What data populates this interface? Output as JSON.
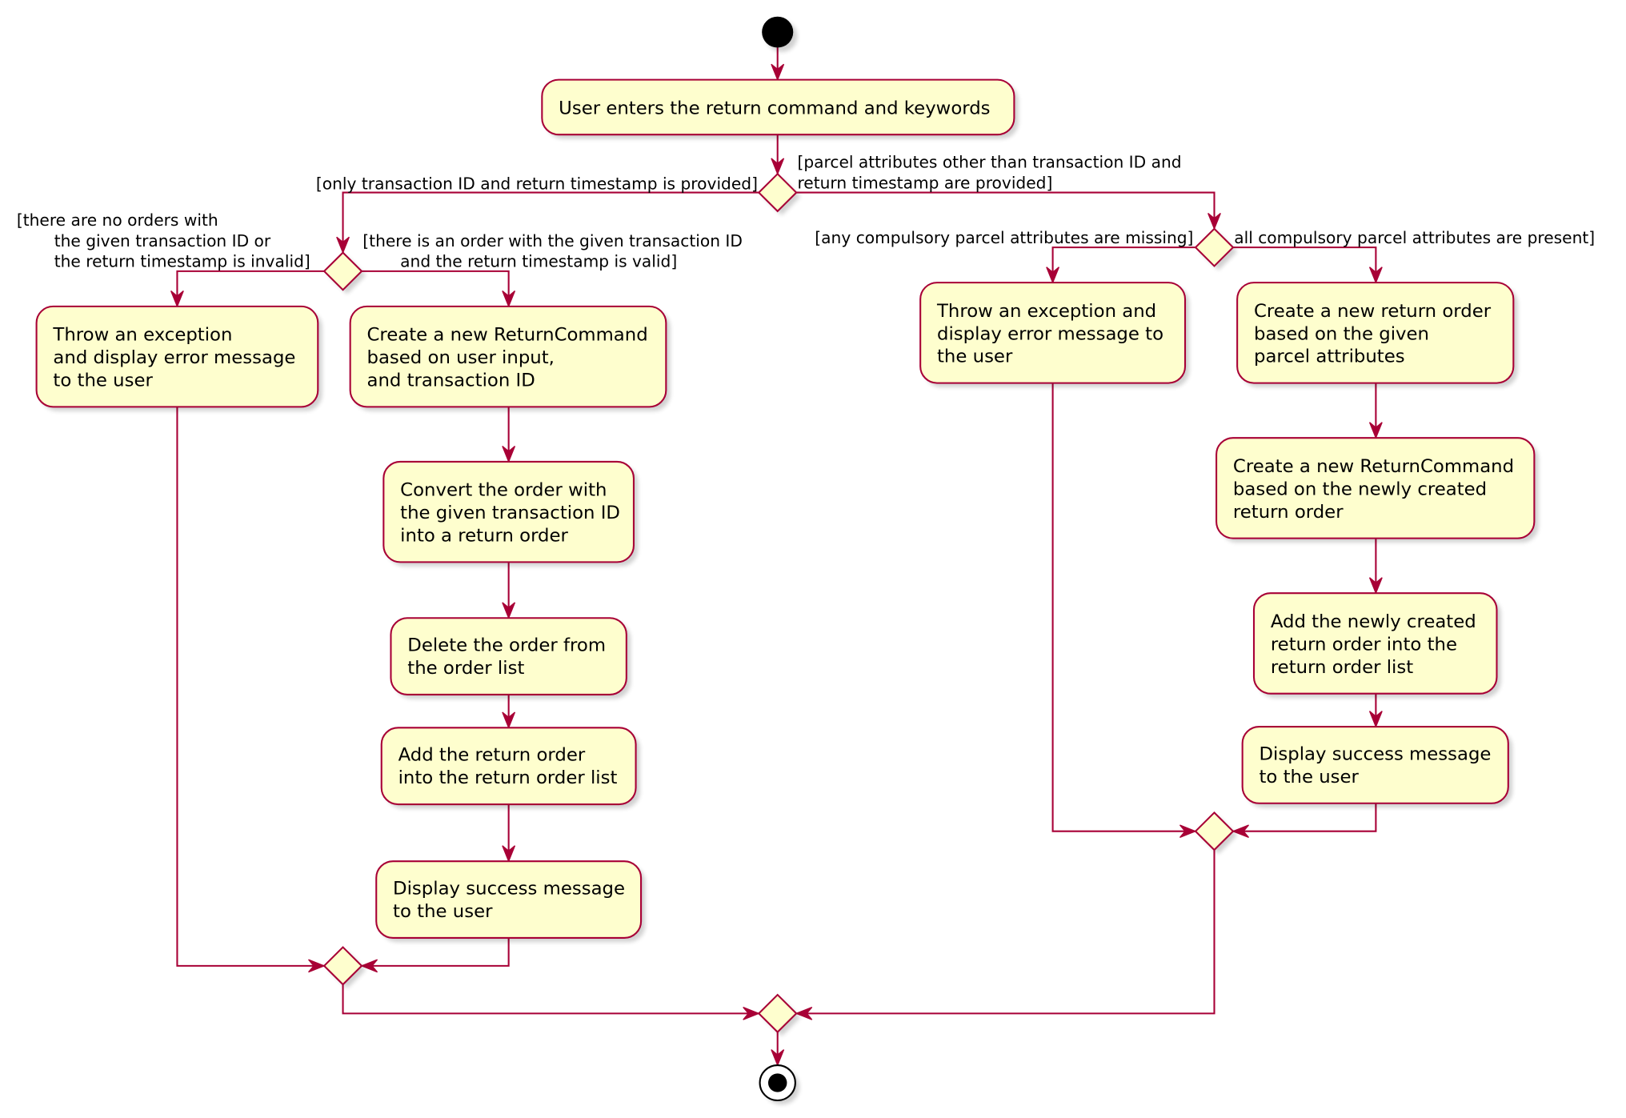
{
  "colors": {
    "border": "#A80036",
    "fill": "#FEFECE",
    "node": "#000000"
  },
  "activities": {
    "enter": [
      "User enters the return command and keywords"
    ],
    "throw_left": [
      "Throw an exception",
      "and display error message",
      "to the user"
    ],
    "create_cmd_txn": [
      "Create a new ReturnCommand",
      "based on user input,",
      "and transaction ID"
    ],
    "convert": [
      "Convert the order with",
      "the given transaction ID",
      "into a return order"
    ],
    "delete": [
      "Delete the order from",
      "the order list"
    ],
    "add_return": [
      "Add the return order",
      "into the return order list"
    ],
    "success_left": [
      "Display success message",
      "to the user"
    ],
    "throw_right": [
      "Throw an exception and",
      "display error message to",
      "the user"
    ],
    "create_order": [
      "Create a new return order",
      "based on the given",
      "parcel attributes"
    ],
    "create_cmd_new": [
      "Create a new ReturnCommand",
      "based on the newly created",
      "return order"
    ],
    "add_new": [
      "Add the newly created",
      "return order into the",
      "return order list"
    ],
    "success_right": [
      "Display success message",
      "to the user"
    ]
  },
  "guards": {
    "only_txn": [
      "[only transaction ID and return timestamp is provided]"
    ],
    "other_attrs": [
      "[parcel attributes other than transaction ID and",
      "return timestamp are provided]"
    ],
    "no_orders": [
      "[there are no orders with",
      "the given transaction ID or",
      "the return timestamp is invalid]"
    ],
    "order_exists": [
      "[there is an order with the given transaction ID",
      "and the return timestamp is valid]"
    ],
    "missing": [
      "[any compulsory parcel attributes are missing]"
    ],
    "present": [
      "all compulsory parcel attributes are present]"
    ]
  }
}
